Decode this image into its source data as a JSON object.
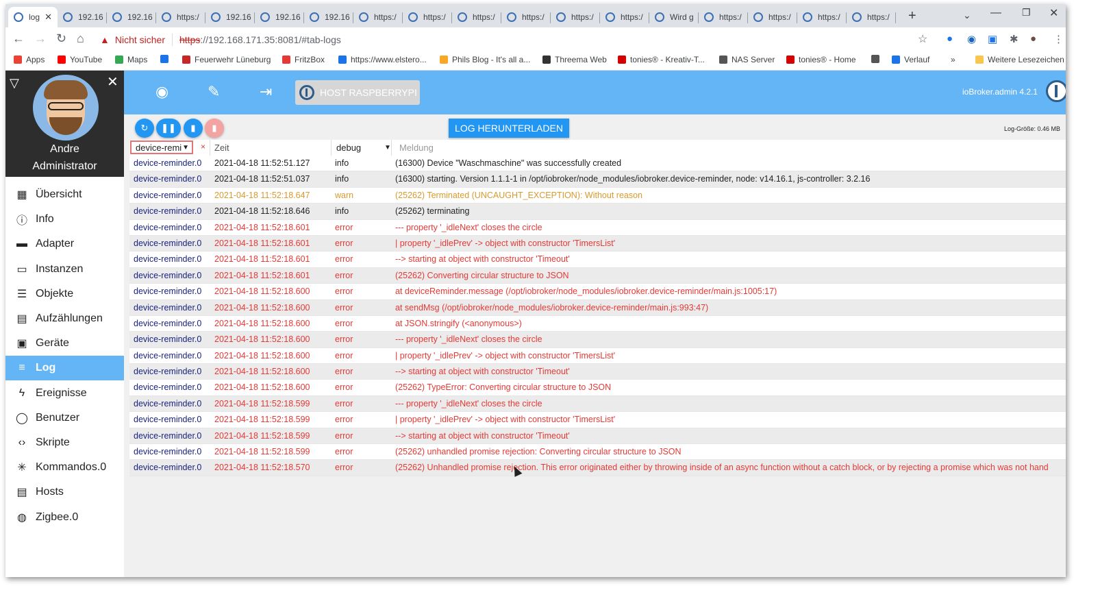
{
  "browser": {
    "tabs": [
      {
        "title": "log",
        "active": true
      },
      {
        "title": "192.16"
      },
      {
        "title": "192.16"
      },
      {
        "title": "https:/"
      },
      {
        "title": "192.16"
      },
      {
        "title": "192.16"
      },
      {
        "title": "192.16"
      },
      {
        "title": "https:/"
      },
      {
        "title": "https:/"
      },
      {
        "title": "https:/"
      },
      {
        "title": "https:/"
      },
      {
        "title": "https:/"
      },
      {
        "title": "https:/"
      },
      {
        "title": "Wird g"
      },
      {
        "title": "https:/"
      },
      {
        "title": "https:/"
      },
      {
        "title": "https:/"
      },
      {
        "title": "https:/"
      }
    ],
    "new_tab": "+",
    "address": {
      "security_label": "Nicht sicher",
      "url_protocol": "https",
      "url_rest": "://192.168.171.35:8081/#tab-logs"
    },
    "bookmarks": [
      {
        "label": "Apps",
        "color": "#ea4335"
      },
      {
        "label": "YouTube",
        "color": "#ff0000"
      },
      {
        "label": "Maps",
        "color": "#34a853"
      },
      {
        "label": "",
        "color": "#1a73e8"
      },
      {
        "label": "Feuerwehr Lüneburg",
        "color": "#c62828"
      },
      {
        "label": "FritzBox",
        "color": "#e53935"
      },
      {
        "label": "https://www.elstero...",
        "color": "#1a73e8"
      },
      {
        "label": "Phils Blog - It's all a...",
        "color": "#f9a825"
      },
      {
        "label": "Threema Web",
        "color": "#333333"
      },
      {
        "label": "tonies® - Kreativ-T...",
        "color": "#d50000"
      },
      {
        "label": "NAS Server",
        "color": "#555555"
      },
      {
        "label": "tonies® - Home",
        "color": "#d50000"
      },
      {
        "label": "",
        "color": "#555555"
      },
      {
        "label": "Verlauf",
        "color": "#1a73e8"
      }
    ],
    "more_bookmarks": "»",
    "other_bookmarks": "Weitere Lesezeichen"
  },
  "sidebar": {
    "user_name": "Andre",
    "user_role": "Administrator",
    "items": [
      {
        "label": "Übersicht",
        "icon": "grid-icon"
      },
      {
        "label": "Info",
        "icon": "info-icon"
      },
      {
        "label": "Adapter",
        "icon": "store-icon"
      },
      {
        "label": "Instanzen",
        "icon": "instances-icon"
      },
      {
        "label": "Objekte",
        "icon": "list-icon"
      },
      {
        "label": "Aufzählungen",
        "icon": "enum-icon"
      },
      {
        "label": "Geräte",
        "icon": "devices-icon"
      },
      {
        "label": "Log",
        "icon": "log-icon",
        "active": true
      },
      {
        "label": "Ereignisse",
        "icon": "flash-icon"
      },
      {
        "label": "Benutzer",
        "icon": "user-icon"
      },
      {
        "label": "Skripte",
        "icon": "code-icon"
      },
      {
        "label": "Kommandos.0",
        "icon": "snowflake-icon"
      },
      {
        "label": "Hosts",
        "icon": "hosts-icon"
      },
      {
        "label": "Zigbee.0",
        "icon": "zigbee-icon"
      }
    ]
  },
  "header": {
    "host_button": "HOST RASPBERRYPI",
    "version": "ioBroker.admin 4.2.1",
    "accent": "#64b5f6"
  },
  "log": {
    "download_label": "LOG HERUNTERLADEN",
    "size_label": "Log-Größe: 0.46 MB",
    "source_filter": "device-remi",
    "clear_filter": "×",
    "time_header": "Zeit",
    "level_filter": "debug",
    "message_placeholder": "Meldung",
    "rows": [
      {
        "src": "device-reminder.0",
        "time": "2021-04-18 11:52:51.127",
        "level": "info",
        "msg": "(16300) Device \"Waschmaschine\" was successfully created"
      },
      {
        "src": "device-reminder.0",
        "time": "2021-04-18 11:52:51.037",
        "level": "info",
        "msg": "(16300) starting. Version 1.1.1-1 in /opt/iobroker/node_modules/iobroker.device-reminder, node: v14.16.1, js-controller: 3.2.16"
      },
      {
        "src": "device-reminder.0",
        "time": "2021-04-18 11:52:18.647",
        "level": "warn",
        "msg": "(25262) Terminated (UNCAUGHT_EXCEPTION): Without reason"
      },
      {
        "src": "device-reminder.0",
        "time": "2021-04-18 11:52:18.646",
        "level": "info",
        "msg": "(25262) terminating"
      },
      {
        "src": "device-reminder.0",
        "time": "2021-04-18 11:52:18.601",
        "level": "error",
        "msg": "--- property '_idleNext' closes the circle"
      },
      {
        "src": "device-reminder.0",
        "time": "2021-04-18 11:52:18.601",
        "level": "error",
        "msg": "| property '_idlePrev' -> object with constructor 'TimersList'"
      },
      {
        "src": "device-reminder.0",
        "time": "2021-04-18 11:52:18.601",
        "level": "error",
        "msg": "--> starting at object with constructor 'Timeout'"
      },
      {
        "src": "device-reminder.0",
        "time": "2021-04-18 11:52:18.601",
        "level": "error",
        "msg": "(25262) Converting circular structure to JSON"
      },
      {
        "src": "device-reminder.0",
        "time": "2021-04-18 11:52:18.600",
        "level": "error",
        "msg": "at deviceReminder.message (/opt/iobroker/node_modules/iobroker.device-reminder/main.js:1005:17)"
      },
      {
        "src": "device-reminder.0",
        "time": "2021-04-18 11:52:18.600",
        "level": "error",
        "msg": "at sendMsg (/opt/iobroker/node_modules/iobroker.device-reminder/main.js:993:47)"
      },
      {
        "src": "device-reminder.0",
        "time": "2021-04-18 11:52:18.600",
        "level": "error",
        "msg": "at JSON.stringify (<anonymous>)"
      },
      {
        "src": "device-reminder.0",
        "time": "2021-04-18 11:52:18.600",
        "level": "error",
        "msg": "--- property '_idleNext' closes the circle"
      },
      {
        "src": "device-reminder.0",
        "time": "2021-04-18 11:52:18.600",
        "level": "error",
        "msg": "| property '_idlePrev' -> object with constructor 'TimersList'"
      },
      {
        "src": "device-reminder.0",
        "time": "2021-04-18 11:52:18.600",
        "level": "error",
        "msg": "--> starting at object with constructor 'Timeout'"
      },
      {
        "src": "device-reminder.0",
        "time": "2021-04-18 11:52:18.600",
        "level": "error",
        "msg": "(25262) TypeError: Converting circular structure to JSON"
      },
      {
        "src": "device-reminder.0",
        "time": "2021-04-18 11:52:18.599",
        "level": "error",
        "msg": "--- property '_idleNext' closes the circle"
      },
      {
        "src": "device-reminder.0",
        "time": "2021-04-18 11:52:18.599",
        "level": "error",
        "msg": "| property '_idlePrev' -> object with constructor 'TimersList'"
      },
      {
        "src": "device-reminder.0",
        "time": "2021-04-18 11:52:18.599",
        "level": "error",
        "msg": "--> starting at object with constructor 'Timeout'"
      },
      {
        "src": "device-reminder.0",
        "time": "2021-04-18 11:52:18.599",
        "level": "error",
        "msg": "(25262) unhandled promise rejection: Converting circular structure to JSON"
      },
      {
        "src": "device-reminder.0",
        "time": "2021-04-18 11:52:18.570",
        "level": "error",
        "msg": "(25262) Unhandled promise rejection. This error originated either by throwing inside of an async function without a catch block, or by rejecting a promise which was not hand"
      }
    ]
  }
}
